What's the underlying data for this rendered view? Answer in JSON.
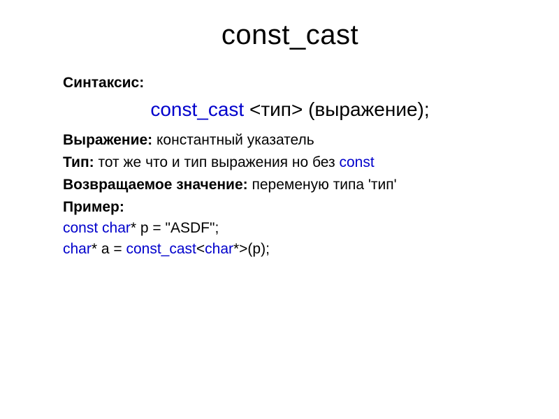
{
  "title": "const_cast",
  "syntax_label": "Синтаксис:",
  "keyword": "const_cast",
  "syntax_template": " <тип> (выражение);",
  "rows": {
    "expression_label": "Выражение: ",
    "expression_value": "константный указатель",
    "type_label": "Тип: ",
    "type_value_1": "тот же что и тип выражения но без ",
    "type_value_kw": "const",
    "return_label": "Возвращаемое значение: ",
    "return_value": " переменую типа 'тип'"
  },
  "example_label": "Пример:",
  "code": {
    "line1_kw1": "const",
    "line1_kw2": "char",
    "line1_rest": "* p = \"ASDF\";",
    "line2_kw1": "char",
    "line2_mid": "* a = ",
    "line2_kw2": "const_cast",
    "line2_rest1": "<",
    "line2_kw3": "char",
    "line2_rest2": "*>(p);"
  }
}
